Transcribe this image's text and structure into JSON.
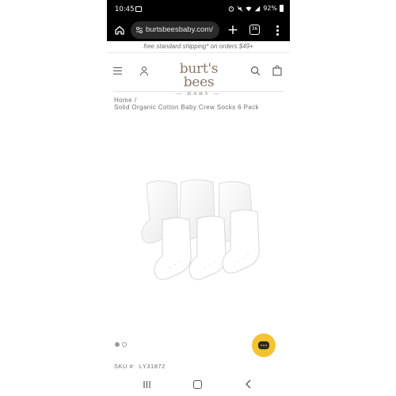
{
  "status_bar": {
    "time": "10:45",
    "battery": "92%",
    "icons": [
      "image-icon",
      "alarm-icon",
      "mute-icon",
      "wifi-icon",
      "signal-icon",
      "battery-icon"
    ]
  },
  "browser": {
    "url": "burtsbeesbaby.com/",
    "tab_count": "36",
    "new_tab_label": "+"
  },
  "promo": {
    "text": "free standard shipping* on orders $49+"
  },
  "header": {
    "logo_main": "burt's bees",
    "logo_sub": "BABY"
  },
  "breadcrumb": {
    "home": "Home",
    "separator": "/",
    "current": "Solid Organic Cotton Baby Crew Socks 6 Pack"
  },
  "product": {
    "image_icon": "socks-image",
    "carousel_total": 2,
    "carousel_active": 1
  },
  "sku": {
    "label": "SKU #:",
    "value": "LY31872"
  },
  "colors": {
    "logo": "#8a7667",
    "chat_bubble": "#f5c232",
    "browser_bg": "#000000"
  }
}
